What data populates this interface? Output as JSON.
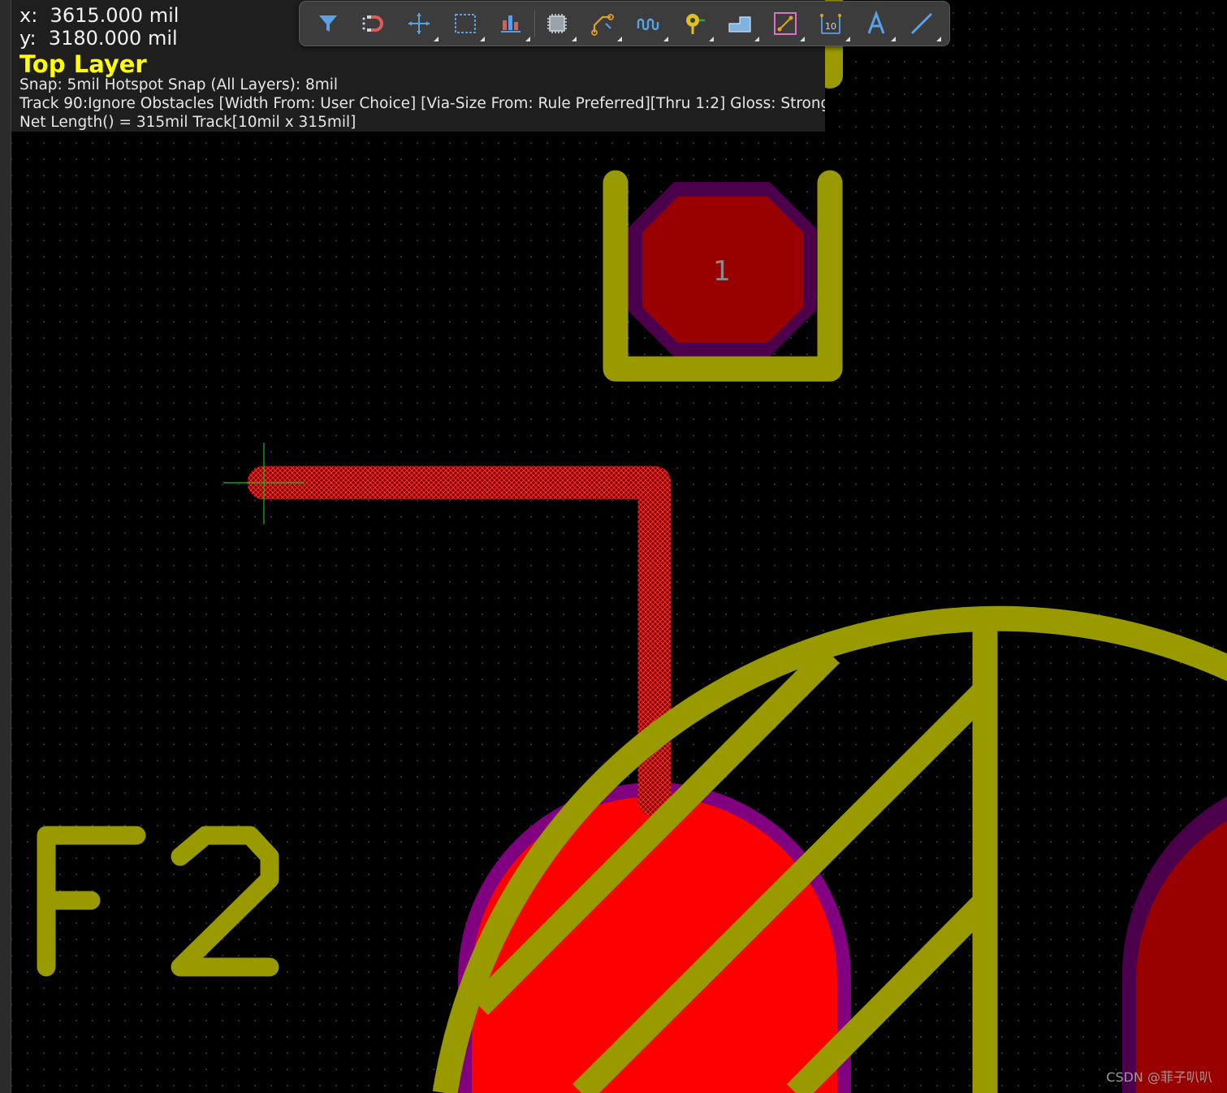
{
  "hud": {
    "x_readout": "x:  3615.000 mil",
    "y_readout": "y:  3180.000 mil",
    "layer": "Top Layer",
    "snap": "Snap: 5mil Hotspot Snap (All Layers): 8mil",
    "track_mode": "Track 90:Ignore Obstacles [Width From: User Choice] [Via-Size From: Rule Preferred][Thru 1:2] Gloss: Strong",
    "net_length": "Net Length() = 315mil Track[10mil x 315mil]"
  },
  "toolbar": {
    "buttons": [
      {
        "name": "filter",
        "icon": "filter-icon"
      },
      {
        "name": "snap",
        "icon": "magnet-icon"
      },
      {
        "name": "move",
        "icon": "move-icon"
      },
      {
        "name": "select",
        "icon": "select-rect-icon"
      },
      {
        "name": "align",
        "icon": "align-icon"
      },
      {
        "name": "component",
        "icon": "chip-icon"
      },
      {
        "name": "interactive-routing",
        "icon": "route-icon"
      },
      {
        "name": "length-tuning",
        "icon": "meander-icon"
      },
      {
        "name": "via",
        "icon": "via-icon"
      },
      {
        "name": "polygon",
        "icon": "polygon-icon"
      },
      {
        "name": "keepout",
        "icon": "keepout-icon"
      },
      {
        "name": "dimension",
        "icon": "dimension-icon"
      },
      {
        "name": "string",
        "icon": "text-icon"
      },
      {
        "name": "line",
        "icon": "line-icon"
      }
    ]
  },
  "board": {
    "pad_label": "1",
    "designator": "F2"
  },
  "colors": {
    "silkscreen": "#999900",
    "top_pad": "#990000",
    "solder_mask": "#4c004c",
    "track": "#cc0000",
    "highlight_pad": "#ff0000",
    "cursor": "#18c018",
    "layer_label": "#ffff00"
  },
  "watermark": "CSDN @菲子叭叭"
}
